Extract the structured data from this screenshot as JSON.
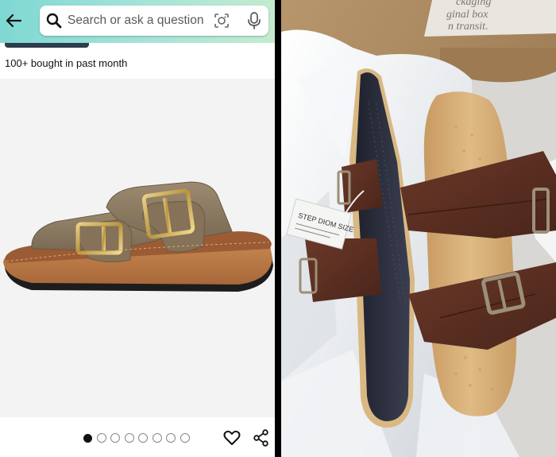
{
  "search": {
    "placeholder": "Search or ask a question"
  },
  "listing": {
    "purchase_count": "100+ bought in past month"
  },
  "carousel": {
    "total": 8,
    "active": 1
  },
  "box_print": {
    "line1": "ckaging",
    "line2": "ginal box",
    "line3": "n transit."
  },
  "tag": {
    "text": "STEP DIOM SIZE"
  },
  "colors": {
    "top_bar_start": "#7fd8d3",
    "top_bar_end": "#c4ebcf",
    "listing_sandal_suede": "#8c7a62",
    "listing_sandal_cork": "#b5723e",
    "received_sandal_strap": "#5a2e22",
    "received_sandal_footbed": "#d8b27c",
    "received_sandal_sole": "#2c2f3d"
  },
  "icons": {
    "back": "arrow-left-icon",
    "search": "search-icon",
    "camera": "camera-lens-icon",
    "mic": "microphone-icon",
    "wishlist": "heart-icon",
    "share": "share-icon"
  }
}
